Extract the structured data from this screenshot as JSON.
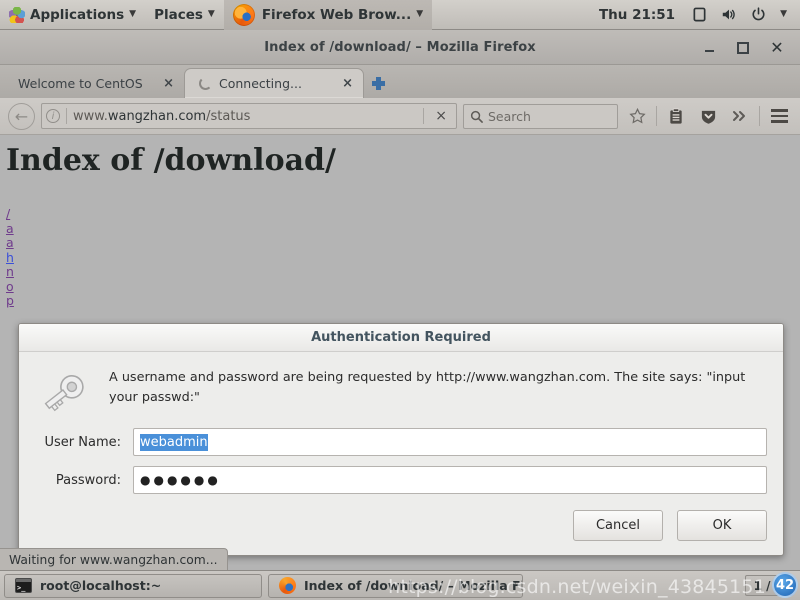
{
  "desktop": {
    "panel": {
      "applications_label": "Applications",
      "places_label": "Places",
      "active_app_label": "Firefox Web Brow...",
      "clock": "Thu 21:51",
      "icons": [
        "gnome-foot-icon",
        "display-icon",
        "volume-icon",
        "power-icon",
        "chevron-down-icon"
      ]
    },
    "taskbar": {
      "items": [
        {
          "label": "root@localhost:~",
          "icon": "terminal-icon"
        },
        {
          "label": "Index of /download/ – Mozilla Fire...",
          "icon": "firefox-icon"
        }
      ],
      "workspace_indicator": "1 / 4"
    },
    "watermark": {
      "text": "https://blog.csdn.net/weixin_43845151",
      "badge": "42"
    }
  },
  "browser": {
    "window_title": "Index of /download/ – Mozilla Firefox",
    "window_buttons": [
      "minimize",
      "maximize",
      "close"
    ],
    "tabs": [
      {
        "label": "Welcome to CentOS",
        "active": false,
        "close_label": "×",
        "icon": "none"
      },
      {
        "label": "Connecting...",
        "active": true,
        "close_label": "×",
        "icon": "loading-spinner-icon"
      }
    ],
    "new_tab_label": "+",
    "navbar": {
      "back_label": "←",
      "identity_icon": "i",
      "url_prefix": "www.",
      "url_host": "wangzhan.com",
      "url_path": "/status",
      "stop_label": "×",
      "search_placeholder": "Search",
      "icons": [
        "search-icon",
        "bookmark-star-icon",
        "library-icon",
        "pocket-shield-icon",
        "overflow-chevrons-icon",
        "menu-hamburger-icon"
      ]
    },
    "statusbar": "Waiting for www.wangzhan.com..."
  },
  "page": {
    "heading": "Index of /download/",
    "links": [
      {
        "text": "/",
        "visited": true
      },
      {
        "text": "a",
        "visited": true
      },
      {
        "text": "a",
        "visited": true
      },
      {
        "text": "h",
        "visited": false
      },
      {
        "text": "n",
        "visited": true
      },
      {
        "text": "o",
        "visited": true
      },
      {
        "text": "p",
        "visited": true
      }
    ]
  },
  "dialog": {
    "title": "Authentication Required",
    "icon": "key-icon",
    "message": "A username and password are being requested by http://www.wangzhan.com. The site says: \"input your passwd:\"",
    "fields": [
      {
        "label": "User Name:",
        "value": "webadmin",
        "selected": true,
        "masked": false
      },
      {
        "label": "Password:",
        "value": "●●●●●●",
        "selected": false,
        "masked": true
      }
    ],
    "buttons": [
      {
        "label": "Cancel",
        "name": "cancel-button"
      },
      {
        "label": "OK",
        "name": "ok-button"
      }
    ]
  },
  "colors": {
    "selection": "#4a90d9",
    "link_visited": "#6f3b8c",
    "link_unvisited": "#3a4fd8",
    "desktop_grey": "#b4b4b4",
    "dialog_bg": "#ededeb"
  }
}
